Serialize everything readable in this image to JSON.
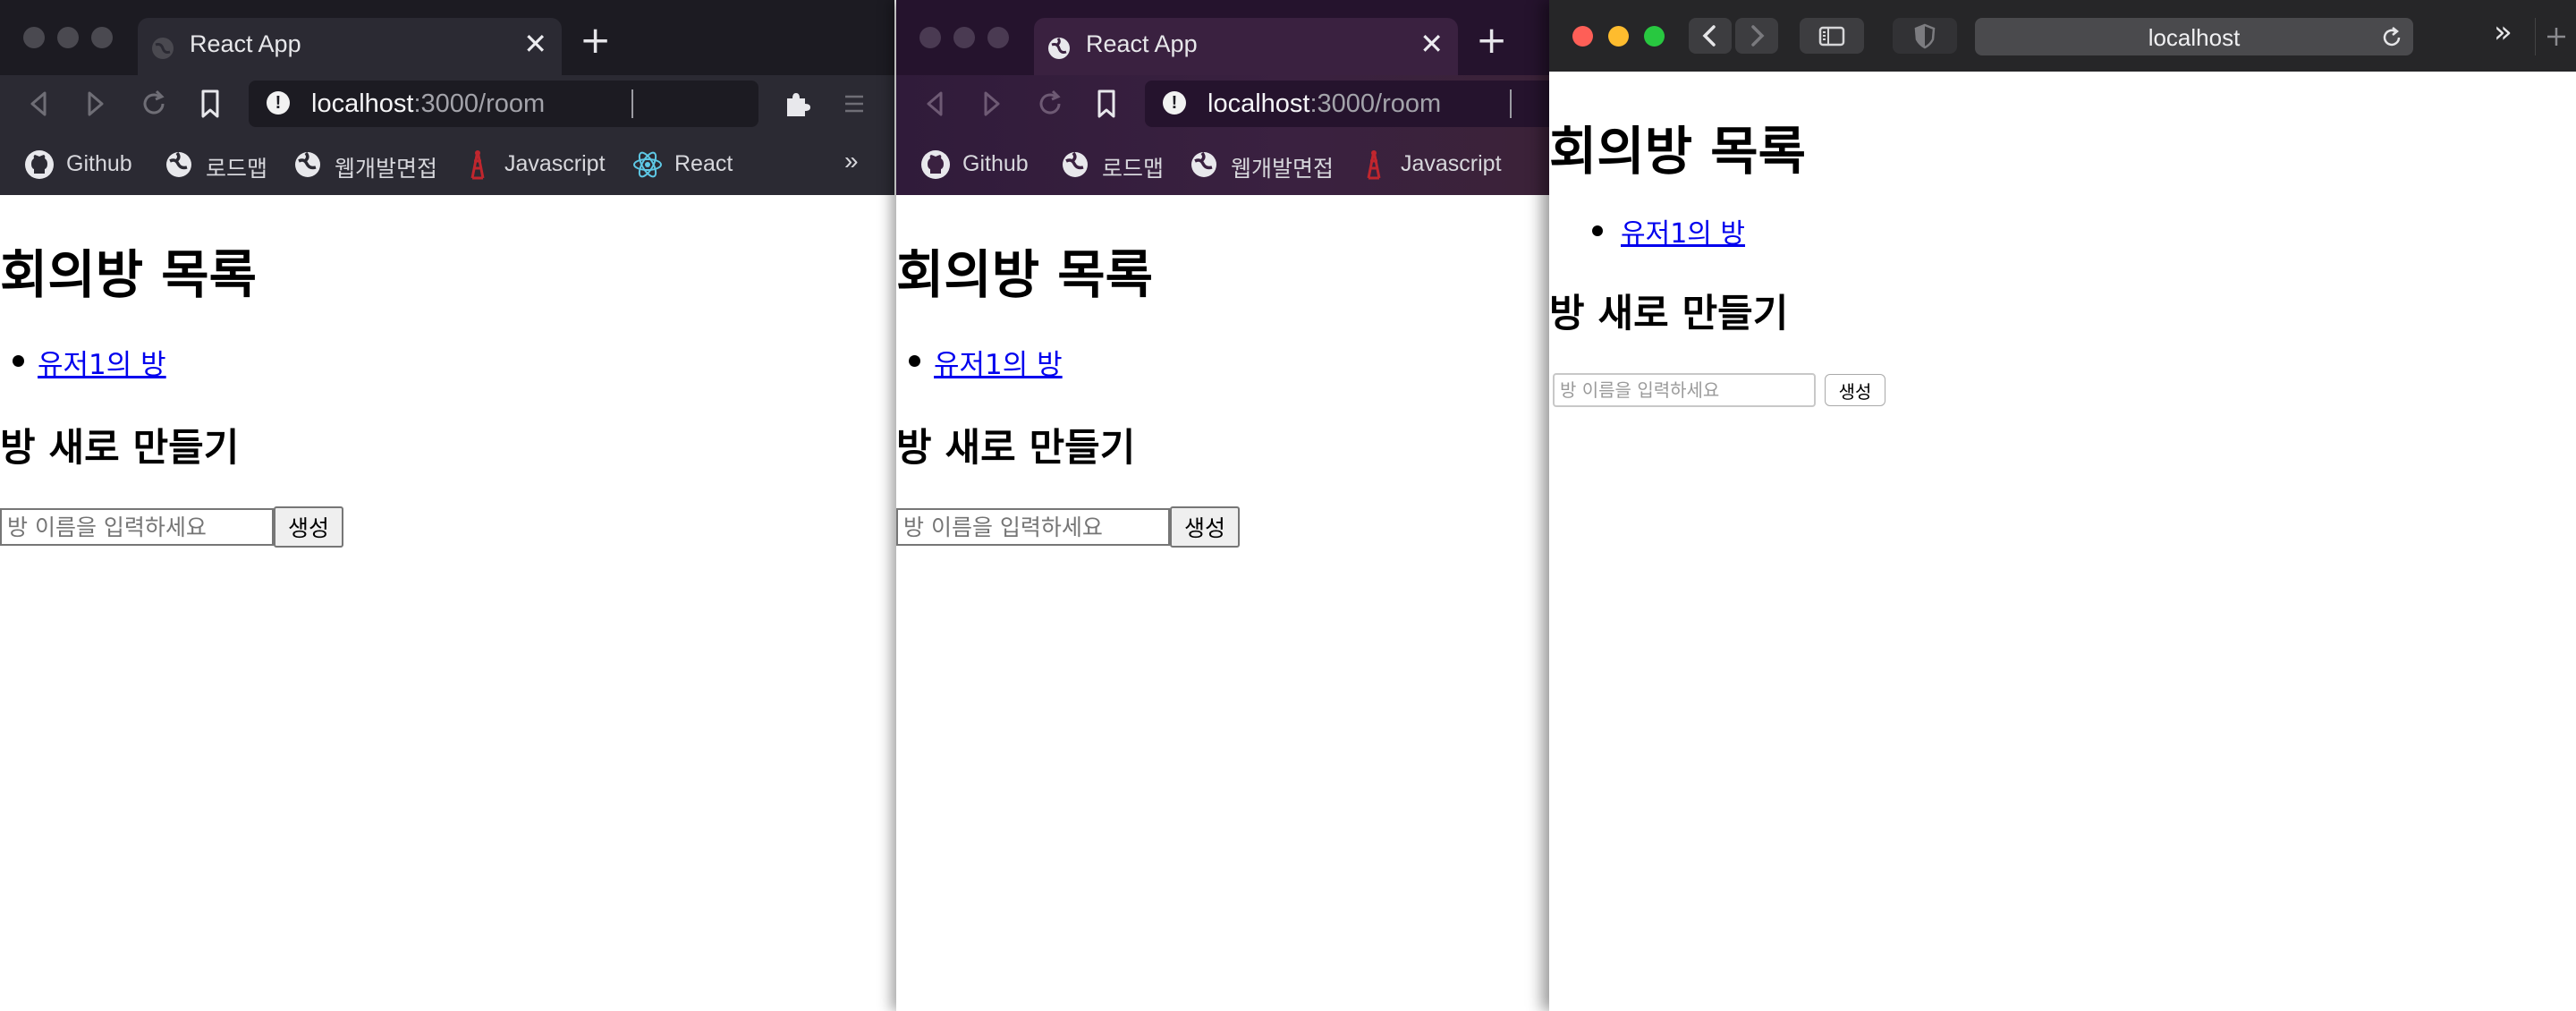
{
  "windows": [
    {
      "tab_title": "React App",
      "url_host": "localhost",
      "url_path": ":3000/room",
      "bookmarks": [
        "Github",
        "로드맵",
        "웹개발면접",
        "Javascript",
        "React"
      ],
      "bookmarks_overflow": "»",
      "page": {
        "heading": "회의방 목록",
        "rooms": [
          "유저1의 방"
        ],
        "create_heading": "방 새로 만들기",
        "input_placeholder": "방 이름을 입력하세요",
        "create_button": "생성"
      }
    },
    {
      "tab_title": "React App",
      "url_host": "localhost",
      "url_path": ":3000/room",
      "bookmarks": [
        "Github",
        "로드맵",
        "웹개발면접",
        "Javascript"
      ],
      "page": {
        "heading": "회의방 목록",
        "rooms": [
          "유저1의 방"
        ],
        "create_heading": "방 새로 만들기",
        "input_placeholder": "방 이름을 입력하세요",
        "create_button": "생성"
      }
    },
    {
      "address": "localhost",
      "overflow": "»",
      "page": {
        "heading": "회의방 목록",
        "rooms": [
          "유저1의 방"
        ],
        "create_heading": "방 새로 만들기",
        "input_placeholder": "방 이름을 입력하세요",
        "create_button": "생성"
      }
    }
  ],
  "icons": {
    "brave_color": "#fb542b",
    "link_color": "#0000ee",
    "safari_close": "#fe5f57",
    "safari_minimize": "#febc2e",
    "safari_zoom": "#28c840"
  }
}
